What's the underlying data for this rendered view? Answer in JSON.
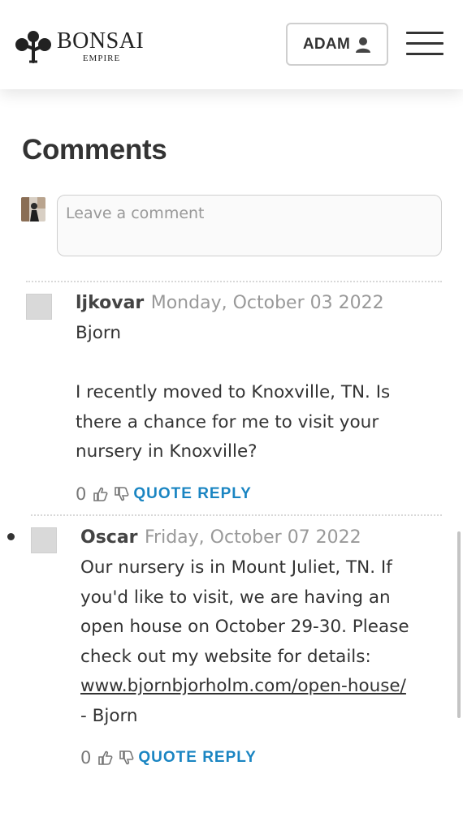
{
  "header": {
    "logo_name": "BONSAI",
    "logo_sub": "EMPIRE",
    "user_label": "ADAM",
    "user_icon": "user-icon",
    "menu_icon": "hamburger-menu-icon"
  },
  "comments_section": {
    "title": "Comments",
    "input_placeholder": "Leave a comment"
  },
  "comments": [
    {
      "author": "ljkovar",
      "date": "Monday, October 03 2022",
      "lines": [
        "Bjorn",
        "",
        "I recently moved to Knoxville, TN.  Is",
        "there a chance for me to visit your",
        "nursery in Knoxville?"
      ],
      "votes": "0",
      "reply_label": "QUOTE REPLY"
    },
    {
      "author": "Oscar",
      "date": "Friday, October 07 2022",
      "lines": [
        "Our nursery is in Mount Juliet, TN.  If",
        "you'd like to visit, we are having an",
        "open house on October 29-30.  Please",
        "check out my website for details:"
      ],
      "link": "www.bjornbjorholm.com/open-house/",
      "signoff": "- Bjorn",
      "votes": "0",
      "reply_label": "QUOTE REPLY"
    }
  ],
  "colors": {
    "accent": "#1a85c2",
    "text": "#333333",
    "muted": "#999999"
  }
}
